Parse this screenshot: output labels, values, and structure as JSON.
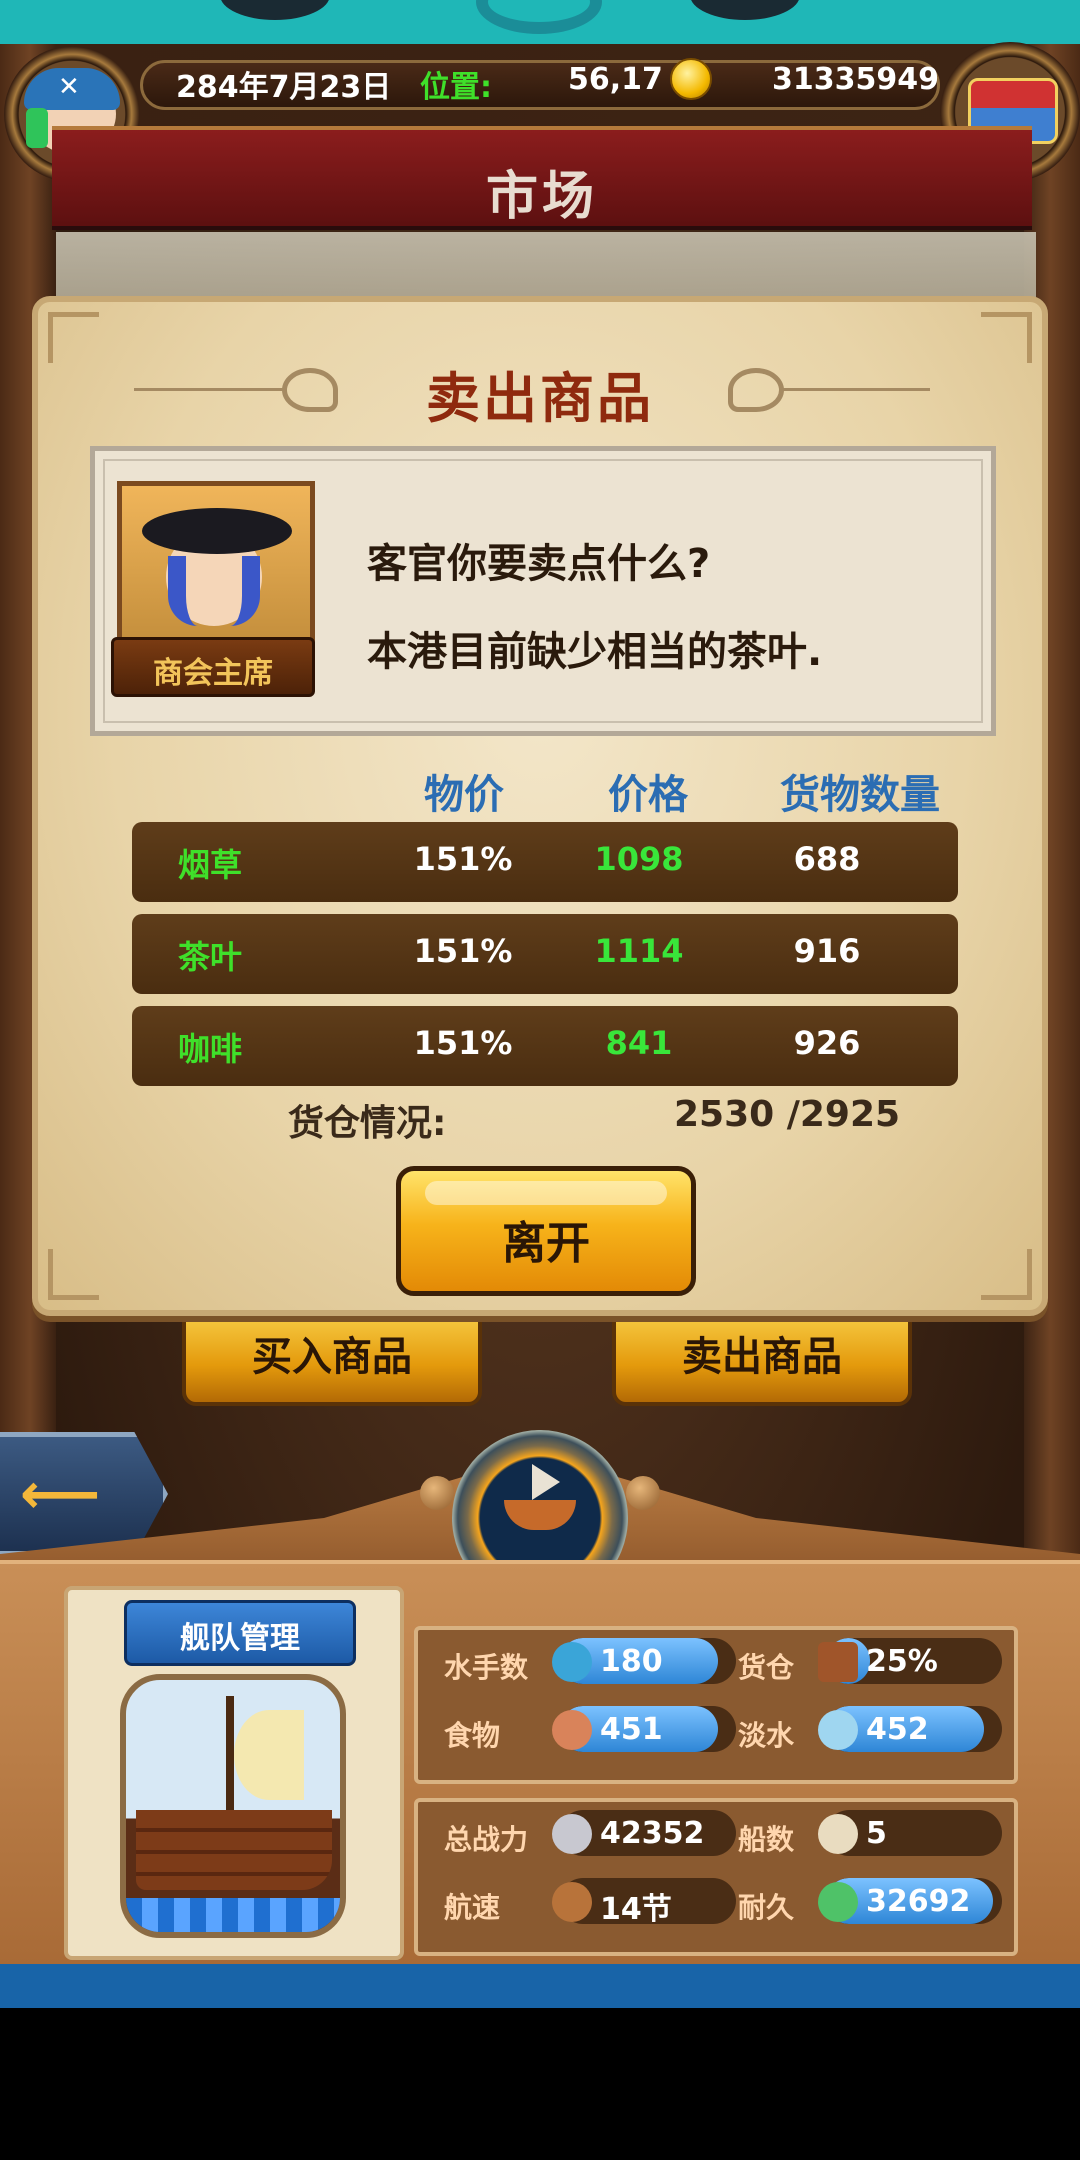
{
  "header": {
    "date": "284年7月23日",
    "position_label": "位置:",
    "position_value": "56,17",
    "gold": "31335949"
  },
  "screen_title": "市场",
  "dialog": {
    "title": "卖出商品",
    "npc_role": "商会主席",
    "npc_line1": "客官你要卖点什么?",
    "npc_line2": "本港目前缺少相当的茶叶.",
    "columns": [
      "物价",
      "价格",
      "货物数量"
    ],
    "goods": [
      {
        "name": "烟草",
        "rate": "151%",
        "price": "1098",
        "qty": "688"
      },
      {
        "name": "茶叶",
        "rate": "151%",
        "price": "1114",
        "qty": "916"
      },
      {
        "name": "咖啡",
        "rate": "151%",
        "price": "841",
        "qty": "926"
      }
    ],
    "storage_label": "货仓情况:",
    "storage_value": "2530 /2925",
    "leave_label": "离开"
  },
  "background_buttons": {
    "buy_label": "买入商品",
    "sell_label": "卖出商品"
  },
  "fleet": {
    "title": "舰队管理",
    "stats": {
      "sailors_label": "水手数",
      "sailors_value": "180",
      "sailors_fill": 0.9,
      "cargo_label": "货仓",
      "cargo_value": "25%",
      "cargo_fill": 0.25,
      "food_label": "食物",
      "food_value": "451",
      "food_fill": 0.9,
      "water_label": "淡水",
      "water_value": "452",
      "water_fill": 0.9,
      "power_label": "总战力",
      "power_value": "42352",
      "ships_label": "船数",
      "ships_value": "5",
      "speed_label": "航速",
      "speed_value": "14节",
      "durability_label": "耐久",
      "durability_value": "32692",
      "durability_fill": 0.95
    }
  },
  "colors": {
    "accent_green": "#3fe02a",
    "header_blue": "#2b6db3",
    "title_red": "#8f2a0e",
    "button_orange": "#f7b31a"
  },
  "icons": [
    "coin-icon",
    "treasure-chest-icon",
    "back-arrow-icon",
    "ship-wheel-icon",
    "sailor-icon",
    "crate-icon",
    "meat-icon",
    "water-jug-icon",
    "swords-icon",
    "sail-icon",
    "boat-icon",
    "anchor-ship-icon"
  ]
}
